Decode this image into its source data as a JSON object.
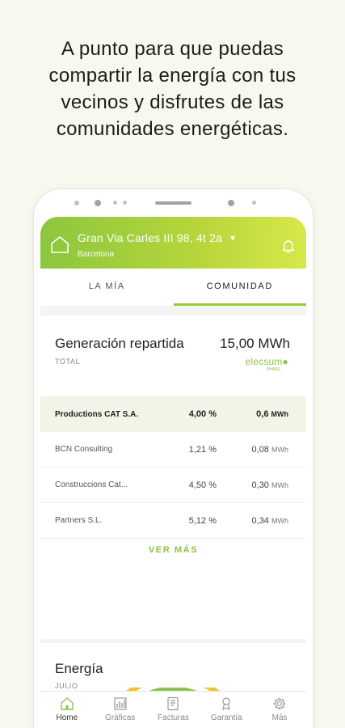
{
  "headline": {
    "line1": "A punto para que puedas",
    "line2": "compartir la energía con tus",
    "line3": "vecinos y disfrutes de las",
    "line4": "comunidades energéticas."
  },
  "header": {
    "address": "Gran Via Carles III 98, 4t 2a",
    "city": "Barcelona",
    "chevron": "▾"
  },
  "tabs": [
    {
      "label": "LA MÍA",
      "active": false
    },
    {
      "label": "COMUNIDAD",
      "active": true
    }
  ],
  "generation": {
    "title": "Generación repartida",
    "total_label": "TOTAL",
    "value": "15,00 MWh",
    "brand": "elecsum",
    "brand_sub": "SHARE"
  },
  "members": [
    {
      "name": "Productions CAT S.A.",
      "pct": "4,00 %",
      "mwh": "0,6",
      "unit": "MWh"
    },
    {
      "name": "BCN Consulting",
      "pct": "1,21 %",
      "mwh": "0,08",
      "unit": "MWh"
    },
    {
      "name": "Construccions Cat...",
      "pct": "4,50 %",
      "mwh": "0,30",
      "unit": "MWh"
    },
    {
      "name": "Partners S.L.",
      "pct": "5,12 %",
      "mwh": "0,34",
      "unit": "MWh"
    }
  ],
  "ver_mas": "VER MÁS",
  "energy": {
    "title": "Energía",
    "month": "JULIO"
  },
  "nav": [
    {
      "label": "Home",
      "icon": "home-icon",
      "active": true
    },
    {
      "label": "Gráficas",
      "icon": "chart-icon",
      "active": false
    },
    {
      "label": "Facturas",
      "icon": "invoice-icon",
      "active": false
    },
    {
      "label": "Garantía",
      "icon": "certificate-icon",
      "active": false
    },
    {
      "label": "Más",
      "icon": "gear-icon",
      "active": false
    }
  ],
  "colors": {
    "accent": "#8bc34a",
    "gauge_outer": "#f2c12e",
    "gauge_middle": "#8bc34a",
    "gauge_inner": "#555555",
    "background": "#f7f8ee"
  }
}
